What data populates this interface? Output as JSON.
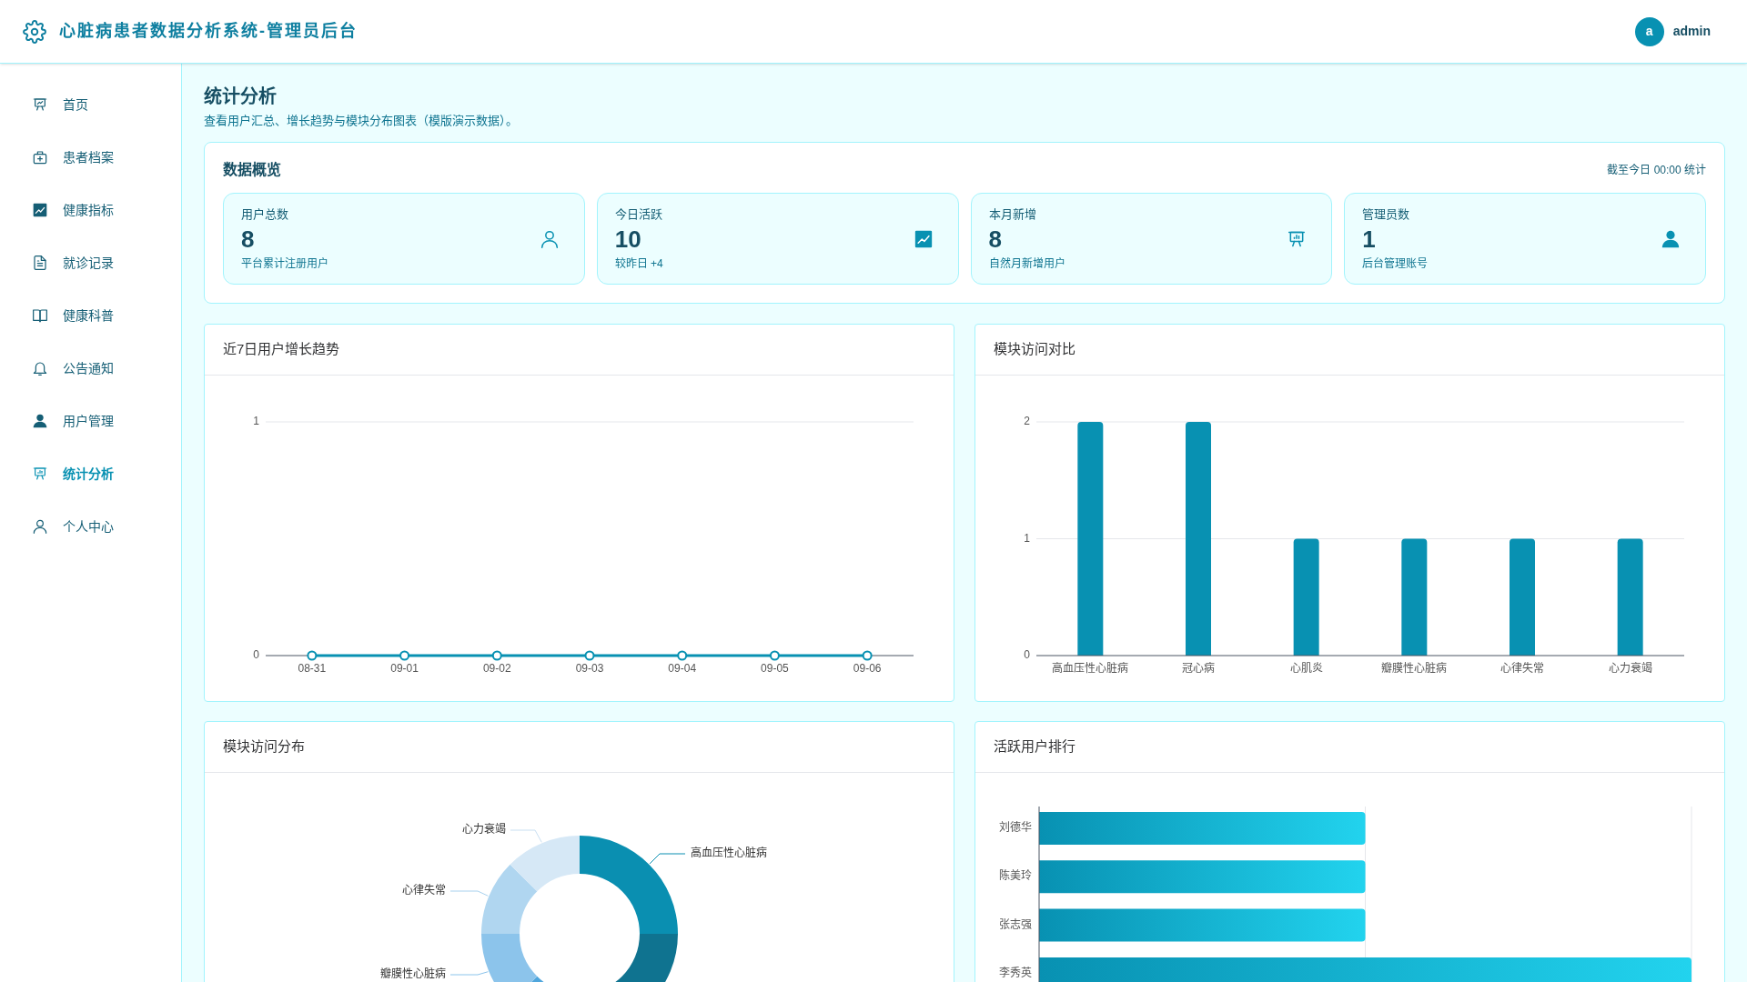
{
  "header": {
    "title": "心脏病患者数据分析系统-管理员后台",
    "avatar": "a",
    "user": "admin"
  },
  "sidebar": {
    "items": [
      {
        "label": "首页",
        "selected": false
      },
      {
        "label": "患者档案",
        "selected": false
      },
      {
        "label": "健康指标",
        "selected": false
      },
      {
        "label": "就诊记录",
        "selected": false
      },
      {
        "label": "健康科普",
        "selected": false
      },
      {
        "label": "公告通知",
        "selected": false
      },
      {
        "label": "用户管理",
        "selected": false
      },
      {
        "label": "统计分析",
        "selected": true
      },
      {
        "label": "个人中心",
        "selected": false
      }
    ]
  },
  "page": {
    "title": "统计分析",
    "subtitle": "查看用户汇总、增长趋势与模块分布图表（模版演示数据）。"
  },
  "overview": {
    "title": "数据概览",
    "note": "截至今日 00:00 统计",
    "stats": [
      {
        "label": "用户总数",
        "value": "8",
        "caption": "平台累计注册用户"
      },
      {
        "label": "今日活跃",
        "value": "10",
        "caption": "较昨日 +4"
      },
      {
        "label": "本月新增",
        "value": "8",
        "caption": "自然月新增用户"
      },
      {
        "label": "管理员数",
        "value": "1",
        "caption": "后台管理账号"
      }
    ]
  },
  "growth_chart": {
    "title": "近7日用户增长趋势",
    "chart_data": {
      "type": "line",
      "categories": [
        "08-31",
        "09-01",
        "09-02",
        "09-03",
        "09-04",
        "09-05",
        "09-06"
      ],
      "series": [
        {
          "color": "#0891b2",
          "marker": "circle",
          "values": [
            0,
            0,
            0,
            0,
            0,
            0,
            0
          ]
        }
      ],
      "ylim": [
        0,
        1
      ],
      "yticks": [
        0,
        1
      ]
    }
  },
  "visits_chart": {
    "title": "模块访问对比",
    "chart_data": {
      "type": "bar",
      "categories": [
        "高血压性心脏病",
        "冠心病",
        "心肌炎",
        "瓣膜性心脏病",
        "心律失常",
        "心力衰竭"
      ],
      "values": [
        2,
        2,
        1,
        1,
        1,
        1
      ],
      "ylim": [
        0,
        2
      ],
      "yticks": [
        0,
        1,
        2
      ]
    }
  },
  "distribution": {
    "title": "模块访问分布",
    "labels": [
      "心力衰竭",
      "高血压性心脏病",
      "心律失常",
      "瓣膜性心脏病"
    ]
  },
  "ranking": {
    "title": "活跃用户排行",
    "names": [
      "刘德华",
      "陈美玲",
      "张志强",
      "李秀英"
    ]
  }
}
